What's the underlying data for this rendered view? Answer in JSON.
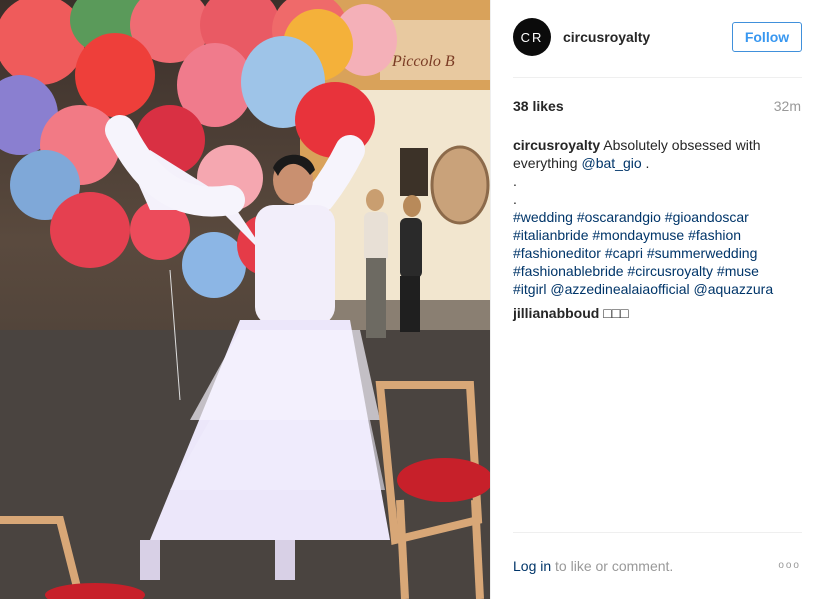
{
  "post": {
    "username": "circusroyalty",
    "avatar_text": "CR",
    "follow_label": "Follow",
    "likes": "38 likes",
    "time": "32m",
    "caption": {
      "author": "circusroyalty",
      "text_1": "Absolutely obsessed with everything",
      "mention": "@bat_gio",
      "text_2": ".",
      "dot_1": ".",
      "dot_2": ".",
      "hashtags": [
        "#wedding",
        "#oscarandgio",
        "#gioandoscar",
        "#italianbride",
        "#mondaymuse",
        "#fashion",
        "#fashioneditor",
        "#capri",
        "#summerwedding",
        "#fashionablebride",
        "#circusroyalty",
        "#muse",
        "#itgirl"
      ],
      "mentions_end": [
        "@azzedinealaiaofficial",
        "@aquazzura"
      ]
    },
    "comment": {
      "author": "jillianabboud",
      "text": "□□□"
    },
    "footer": {
      "login_label": "Log in",
      "rest_label": "to like or comment.",
      "more_icon": "ooo"
    },
    "photo_sign": "Piccolo B"
  }
}
